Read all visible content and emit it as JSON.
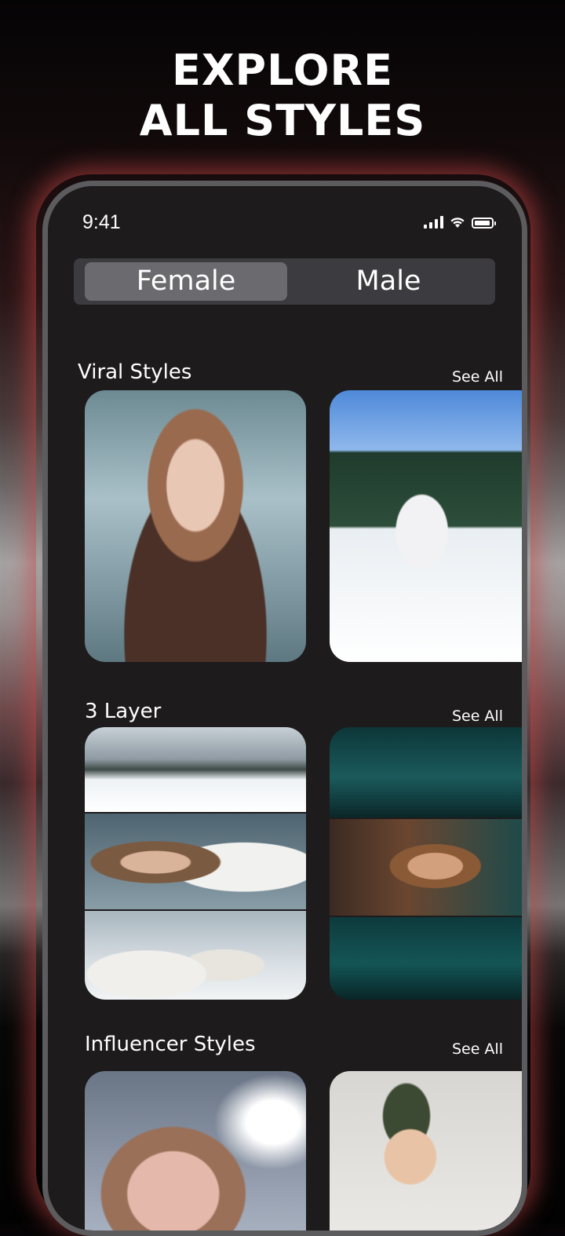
{
  "hero": {
    "line1": "EXPLORE",
    "line2": "ALL STYLES"
  },
  "status": {
    "time": "9:41"
  },
  "tabs": {
    "female": "Female",
    "male": "Male"
  },
  "sections": [
    {
      "title": "Viral Styles",
      "see_all": "See All"
    },
    {
      "title": "3 Layer",
      "see_all": "See All"
    },
    {
      "title": "Influencer Styles",
      "see_all": "See All"
    }
  ],
  "icons": {
    "signal": "cellular-signal-icon",
    "wifi": "wifi-icon",
    "battery": "battery-icon"
  },
  "colors": {
    "accent_glow": "#c84646",
    "tab_active": "#6b6a6f",
    "tab_track": "#3c3b3f",
    "screen_bg": "#1d1b1c"
  }
}
